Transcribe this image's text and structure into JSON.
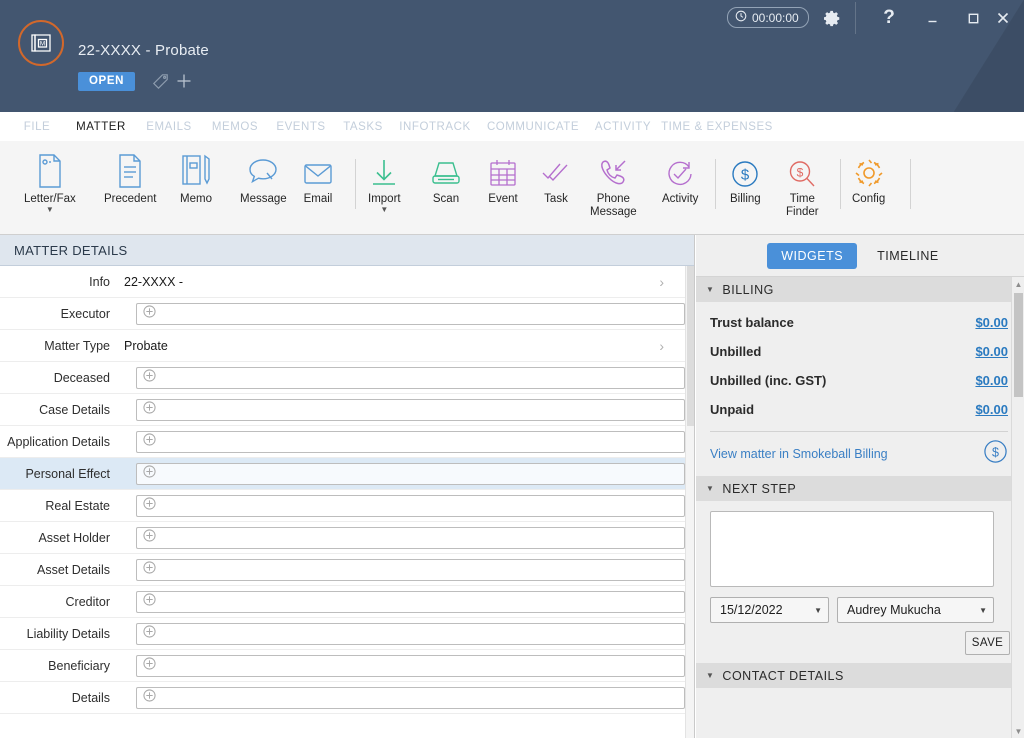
{
  "window": {
    "timer": "00:00:00",
    "timer_icon": "clock-icon",
    "gear_icon": "gear-icon",
    "help_label": "?",
    "minimize_label": "–",
    "maximize_label": "▫",
    "close_label": "✕"
  },
  "header": {
    "matter_title": "22-XXXX  -  Probate",
    "status_badge": "OPEN",
    "avatar_icon": "matter-folder-icon",
    "tag_icon": "tag-icon",
    "add_icon": "plus-icon",
    "bg_color": "#435670",
    "accent_color": "#d2682b"
  },
  "tabs": [
    {
      "label": "FILE",
      "active": false
    },
    {
      "label": "MATTER",
      "active": true
    },
    {
      "label": "EMAILS",
      "active": false
    },
    {
      "label": "MEMOS",
      "active": false
    },
    {
      "label": "EVENTS",
      "active": false
    },
    {
      "label": "TASKS",
      "active": false
    },
    {
      "label": "INFOTRACK",
      "active": false
    },
    {
      "label": "COMMUNICATE",
      "active": false
    },
    {
      "label": "ACTIVITY",
      "active": false
    },
    {
      "label": "TIME & EXPENSES",
      "active": false
    }
  ],
  "ribbon": [
    {
      "label": "Letter/Fax",
      "icon": "letter-fax-icon",
      "color": "#5b9bd5",
      "dropdown": true
    },
    {
      "label": "Precedent",
      "icon": "precedent-icon",
      "color": "#5b9bd5",
      "dropdown": false
    },
    {
      "label": "Memo",
      "icon": "memo-icon",
      "color": "#5b9bd5",
      "dropdown": false
    },
    {
      "label": "Message",
      "icon": "message-icon",
      "color": "#5b9bd5",
      "dropdown": false
    },
    {
      "label": "Email",
      "icon": "email-icon",
      "color": "#5b9bd5",
      "dropdown": false
    },
    {
      "label": "Import",
      "icon": "import-icon",
      "color": "#3bbf8f",
      "dropdown": true
    },
    {
      "label": "Scan",
      "icon": "scan-icon",
      "color": "#3bbf8f",
      "dropdown": false
    },
    {
      "label": "Event",
      "icon": "event-icon",
      "color": "#b56fce",
      "dropdown": false
    },
    {
      "label": "Task",
      "icon": "task-icon",
      "color": "#b56fce",
      "dropdown": false
    },
    {
      "label": "Phone\nMessage",
      "icon": "phone-message-icon",
      "color": "#b56fce",
      "dropdown": false
    },
    {
      "label": "Activity",
      "icon": "activity-icon",
      "color": "#b56fce",
      "dropdown": false
    },
    {
      "label": "Billing",
      "icon": "billing-dollar-icon",
      "color": "#2a7ac0",
      "dropdown": false
    },
    {
      "label": "Time\nFinder",
      "icon": "time-finder-icon",
      "color": "#e06b64",
      "dropdown": false
    },
    {
      "label": "Config",
      "icon": "config-gear-icon",
      "color": "#f09a2b",
      "dropdown": false
    }
  ],
  "matter_details": {
    "title": "MATTER DETAILS",
    "rows": [
      {
        "label": "Info",
        "type": "value",
        "value": "22-XXXX -",
        "indent": false,
        "selected": false
      },
      {
        "label": "Executor",
        "type": "add",
        "value": "",
        "indent": false,
        "selected": false
      },
      {
        "label": "Matter Type",
        "type": "value",
        "value": "Probate",
        "indent": false,
        "selected": false
      },
      {
        "label": "Deceased",
        "type": "add",
        "value": "",
        "indent": false,
        "selected": false
      },
      {
        "label": "Case Details",
        "type": "add",
        "value": "",
        "indent": false,
        "selected": false
      },
      {
        "label": "Application Details",
        "type": "add",
        "value": "",
        "indent": false,
        "selected": false
      },
      {
        "label": "Personal Effect",
        "type": "add",
        "value": "",
        "indent": false,
        "selected": true
      },
      {
        "label": "Real Estate",
        "type": "add",
        "value": "",
        "indent": false,
        "selected": false
      },
      {
        "label": "Asset Holder",
        "type": "add",
        "value": "",
        "indent": false,
        "selected": false
      },
      {
        "label": "Asset Details",
        "type": "add",
        "value": "",
        "indent": true,
        "selected": false
      },
      {
        "label": "Creditor",
        "type": "add",
        "value": "",
        "indent": false,
        "selected": false
      },
      {
        "label": "Liability Details",
        "type": "add",
        "value": "",
        "indent": true,
        "selected": false
      },
      {
        "label": "Beneficiary",
        "type": "add",
        "value": "",
        "indent": false,
        "selected": false
      },
      {
        "label": "Details",
        "type": "add",
        "value": "",
        "indent": true,
        "selected": false
      }
    ]
  },
  "right_panel": {
    "segments": [
      {
        "label": "WIDGETS",
        "active": true
      },
      {
        "label": "TIMELINE",
        "active": false
      }
    ],
    "billing": {
      "title": "BILLING",
      "rows": [
        {
          "label": "Trust balance",
          "amount": "$0.00"
        },
        {
          "label": "Unbilled",
          "amount": "$0.00"
        },
        {
          "label": "Unbilled (inc. GST)",
          "amount": "$0.00"
        },
        {
          "label": "Unpaid",
          "amount": "$0.00"
        }
      ],
      "link_label": "View matter in Smokeball Billing",
      "link_icon": "billing-dollar-icon",
      "link_color": "#3a7fc4"
    },
    "next_step": {
      "title": "NEXT STEP",
      "note_value": "",
      "date_value": "15/12/2022",
      "user_value": "Audrey Mukucha",
      "save_label": "SAVE"
    },
    "contact_details": {
      "title": "CONTACT DETAILS"
    },
    "overflow_label": "•••"
  }
}
